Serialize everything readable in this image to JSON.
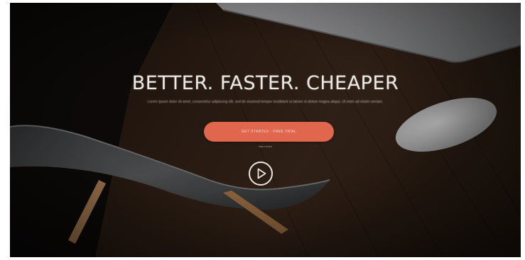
{
  "hero": {
    "headline": "BETTER. FASTER. CHEAPER",
    "subtext": "Lorem ipsum dolor sit amet, consectetur adipiscing elit, sed do eiusmod tempor incididunt ut labore et dolore magna aliqua. Ut enim ad minim veniam.",
    "cta_label": "GET STARTED - FREE TRIAL",
    "secondary_link": "learn more",
    "play_icon": "play-icon"
  },
  "colors": {
    "accent": "#e0664e",
    "background": "#16110d",
    "text": "#ece8e4"
  }
}
